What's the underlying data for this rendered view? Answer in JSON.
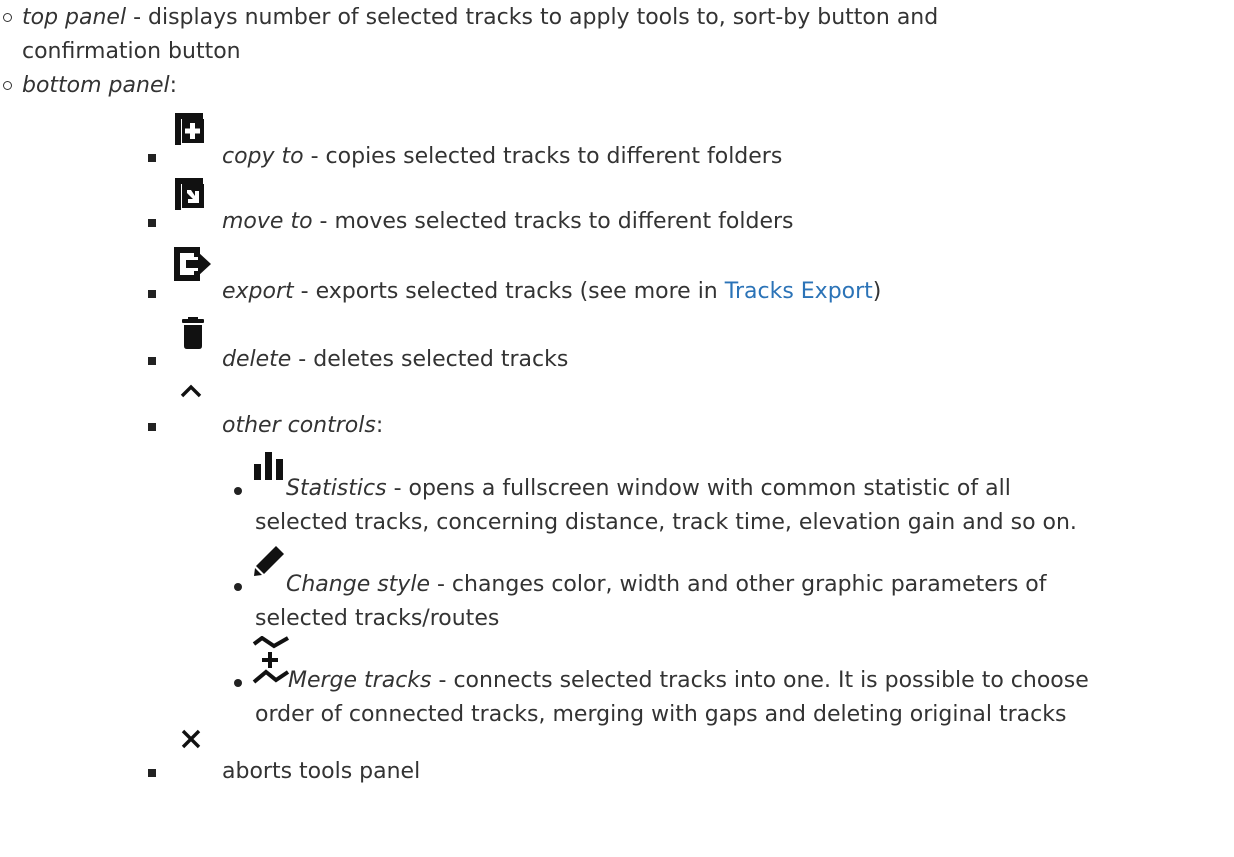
{
  "items": {
    "top_panel": {
      "term": "top panel",
      "desc_line1": " - displays number of selected tracks to apply tools to, sort-by button and",
      "desc_line2": "confirmation button"
    },
    "bottom_panel": {
      "term": "bottom panel",
      "suffix": ":"
    },
    "copy_to": {
      "term": "copy to",
      "desc": " - copies selected tracks to different folders"
    },
    "move_to": {
      "term": "move to",
      "desc": " - moves selected tracks to different folders"
    },
    "export": {
      "term": "export",
      "desc_before": " - exports selected tracks (see more in ",
      "link": "Tracks Export",
      "desc_after": ")"
    },
    "delete": {
      "term": "delete",
      "desc": " - deletes selected tracks"
    },
    "other_controls": {
      "term": "other controls",
      "suffix": ":"
    },
    "statistics": {
      "term": "Statistics",
      "desc_line1": " - opens a fullscreen window with common statistic of all",
      "desc_line2": "selected tracks, concerning distance, track time, elevation gain and so on."
    },
    "change_style": {
      "term": "Change style",
      "desc_line1": " - changes color, width and other graphic parameters of",
      "desc_line2": "selected tracks/routes"
    },
    "merge_tracks": {
      "term": "Merge tracks",
      "desc_line1": " - connects selected tracks into one. It is possible to choose",
      "desc_line2": "order of connected tracks, merging with gaps and deleting original tracks"
    },
    "abort": {
      "desc": "aborts tools panel"
    }
  },
  "icons": {
    "copy": "copy-icon",
    "move": "move-icon",
    "export": "export-icon",
    "delete": "trash-icon",
    "other": "chevron-up-icon",
    "statistics": "bar-chart-icon",
    "style": "pencil-icon",
    "merge": "merge-tracks-icon",
    "close": "close-icon"
  },
  "colors": {
    "text": "#333333",
    "link": "#2b73b7",
    "icon": "#111111"
  }
}
